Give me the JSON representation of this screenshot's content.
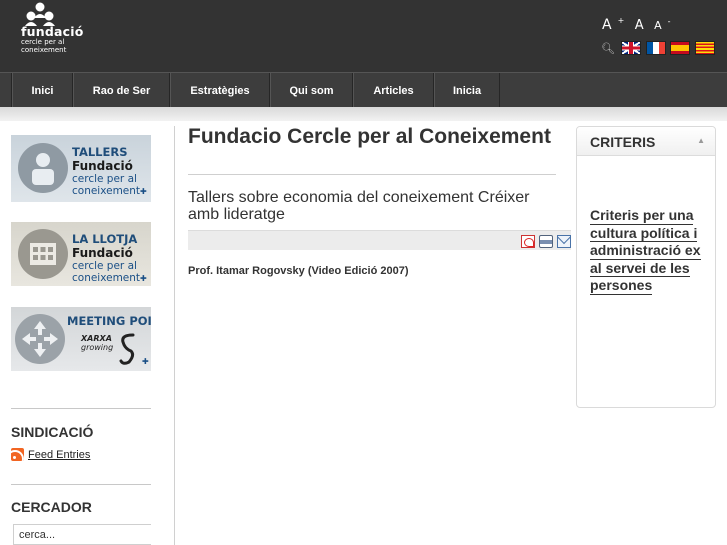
{
  "header": {
    "logo": {
      "name": "fundació",
      "tagline_1": "cercle per al",
      "tagline_2": "coneixement"
    },
    "font_sizer": {
      "increase": "A",
      "increase_sup": "+",
      "reset": "A",
      "decrease": "A",
      "decrease_sup": "-"
    },
    "languages": [
      "English",
      "Français",
      "Español",
      "Català"
    ]
  },
  "nav": {
    "items": [
      {
        "label": "Inici"
      },
      {
        "label": "Rao de Ser"
      },
      {
        "label": "Estratègies"
      },
      {
        "label": "Qui som"
      },
      {
        "label": "Articles"
      },
      {
        "label": "Inicia"
      }
    ]
  },
  "sidebar": {
    "banners": [
      {
        "title": "TALLERS",
        "sub1": "Fundació",
        "sub2a": "cercle per al",
        "sub2b": "coneixement"
      },
      {
        "title": "LA LLOTJA",
        "sub1": "Fundació",
        "sub2a": "cercle per al",
        "sub2b": "coneixement"
      },
      {
        "title": "MEETING POINT",
        "sub_a": "XARXA",
        "sub_b": "growing"
      }
    ],
    "syndication_heading": "SINDICACIÓ",
    "feed_link": "Feed Entries",
    "search_heading": "CERCADOR",
    "search_value": "cerca..."
  },
  "main": {
    "page_title": "Fundacio Cercle per al Coneixement",
    "article_title": "Tallers sobre economia del coneixement Créixer amb lideratge",
    "author": "Prof. Itamar Rogovsky (Video Edició 2007)"
  },
  "criteris": {
    "title": "CRITERIS",
    "toggle": "▲",
    "link_lines": [
      "Criteris per una",
      "cultura política i",
      "administració ex",
      "al servei de les",
      "persones"
    ]
  },
  "colors": {
    "header_bg": "#333333",
    "nav_bg": "#3d3d3d",
    "banner_blue": "#1f4d7a",
    "text": "#333333"
  }
}
